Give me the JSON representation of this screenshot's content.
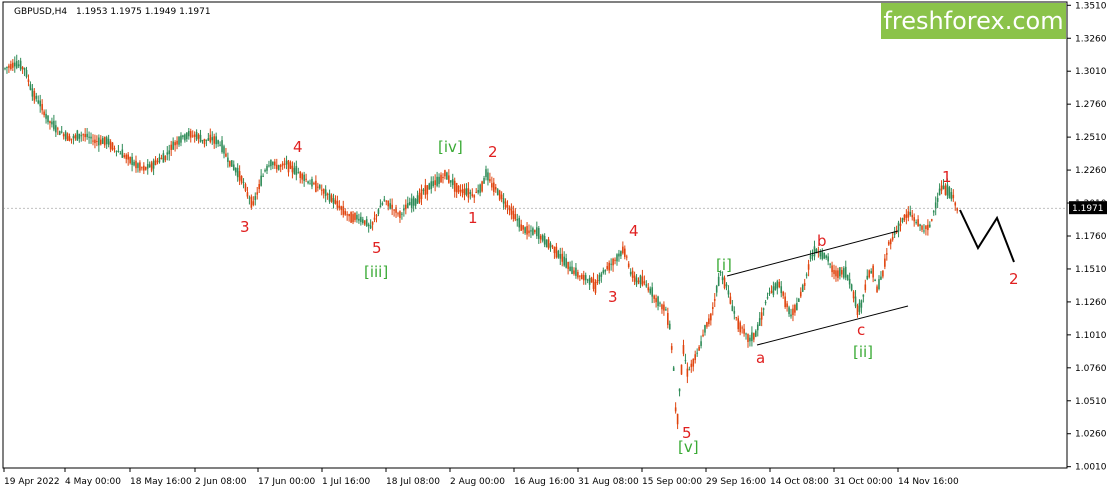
{
  "header": {
    "symbol": "GBPUSD,H4",
    "ohlc": "1.1953 1.1975 1.1949 1.1971"
  },
  "logo": {
    "text": "freshforex.com",
    "color": "#8bc34a"
  },
  "colors": {
    "bull": "#2e8b57",
    "bear": "#e0440e",
    "red_label": "#e02020",
    "green_label": "#3aaa35",
    "channel": "#000000",
    "price_tag_bg": "#000000",
    "grid": "#c8c8c8"
  },
  "chart_data": {
    "type": "candlestick",
    "title": "GBPUSD,H4",
    "ylim": [
      1.0,
      1.3535
    ],
    "yticks": [
      "1.3510",
      "1.3260",
      "1.3010",
      "1.2760",
      "1.2510",
      "1.2260",
      "1.2010",
      "1.1760",
      "1.1510",
      "1.1260",
      "1.1010",
      "1.0760",
      "1.0510",
      "1.0260",
      "1.0010"
    ],
    "xticks": [
      "19 Apr 2022",
      "4 May 00:00",
      "18 May 16:00",
      "2 Jun 08:00",
      "17 Jun 00:00",
      "1 Jul 16:00",
      "18 Jul 08:00",
      "2 Aug 00:00",
      "16 Aug 16:00",
      "31 Aug 08:00",
      "15 Sep 00:00",
      "29 Sep 16:00",
      "14 Oct 08:00",
      "31 Oct 00:00",
      "14 Nov 16:00"
    ],
    "current_price": "1.1971",
    "grid": false,
    "price_path": [
      [
        0,
        1.303
      ],
      [
        5,
        1.307
      ],
      [
        10,
        1.303
      ],
      [
        14,
        1.285
      ],
      [
        18,
        1.276
      ],
      [
        22,
        1.264
      ],
      [
        28,
        1.255
      ],
      [
        34,
        1.25
      ],
      [
        40,
        1.253
      ],
      [
        46,
        1.248
      ],
      [
        52,
        1.248
      ],
      [
        58,
        1.24
      ],
      [
        63,
        1.235
      ],
      [
        67,
        1.23
      ],
      [
        71,
        1.227
      ],
      [
        75,
        1.229
      ],
      [
        78,
        1.233
      ],
      [
        82,
        1.236
      ],
      [
        86,
        1.245
      ],
      [
        90,
        1.25
      ],
      [
        94,
        1.253
      ],
      [
        98,
        1.252
      ],
      [
        102,
        1.248
      ],
      [
        106,
        1.25
      ],
      [
        110,
        1.246
      ],
      [
        115,
        1.232
      ],
      [
        118,
        1.226
      ],
      [
        121,
        1.22
      ],
      [
        124,
        1.208
      ],
      [
        127,
        1.2
      ],
      [
        130,
        1.213
      ],
      [
        133,
        1.226
      ],
      [
        136,
        1.232
      ],
      [
        140,
        1.228
      ],
      [
        144,
        1.231
      ],
      [
        148,
        1.226
      ],
      [
        152,
        1.222
      ],
      [
        156,
        1.216
      ],
      [
        160,
        1.214
      ],
      [
        164,
        1.208
      ],
      [
        168,
        1.203
      ],
      [
        172,
        1.197
      ],
      [
        176,
        1.191
      ],
      [
        180,
        1.19
      ],
      [
        184,
        1.187
      ],
      [
        187,
        1.182
      ],
      [
        190,
        1.192
      ],
      [
        194,
        1.203
      ],
      [
        198,
        1.198
      ],
      [
        202,
        1.192
      ],
      [
        206,
        1.199
      ],
      [
        210,
        1.202
      ],
      [
        214,
        1.21
      ],
      [
        218,
        1.214
      ],
      [
        222,
        1.218
      ],
      [
        225,
        1.223
      ],
      [
        228,
        1.218
      ],
      [
        232,
        1.211
      ],
      [
        236,
        1.21
      ],
      [
        240,
        1.207
      ],
      [
        244,
        1.214
      ],
      [
        246,
        1.223
      ],
      [
        249,
        1.215
      ],
      [
        252,
        1.21
      ],
      [
        256,
        1.201
      ],
      [
        260,
        1.193
      ],
      [
        264,
        1.183
      ],
      [
        268,
        1.179
      ],
      [
        272,
        1.179
      ],
      [
        276,
        1.172
      ],
      [
        280,
        1.168
      ],
      [
        284,
        1.161
      ],
      [
        288,
        1.153
      ],
      [
        292,
        1.148
      ],
      [
        296,
        1.144
      ],
      [
        300,
        1.142
      ],
      [
        302,
        1.138
      ],
      [
        304,
        1.145
      ],
      [
        308,
        1.152
      ],
      [
        312,
        1.158
      ],
      [
        316,
        1.165
      ],
      [
        318,
        1.161
      ],
      [
        320,
        1.148
      ],
      [
        323,
        1.142
      ],
      [
        326,
        1.142
      ],
      [
        330,
        1.135
      ],
      [
        334,
        1.126
      ],
      [
        338,
        1.12
      ],
      [
        340,
        1.108
      ],
      [
        342,
        1.075
      ],
      [
        343,
        1.045
      ],
      [
        344,
        1.038
      ],
      [
        345,
        1.06
      ],
      [
        347,
        1.09
      ],
      [
        349,
        1.073
      ],
      [
        352,
        1.08
      ],
      [
        355,
        1.09
      ],
      [
        358,
        1.105
      ],
      [
        361,
        1.115
      ],
      [
        364,
        1.135
      ],
      [
        366,
        1.148
      ],
      [
        369,
        1.138
      ],
      [
        372,
        1.122
      ],
      [
        375,
        1.11
      ],
      [
        378,
        1.103
      ],
      [
        381,
        1.097
      ],
      [
        384,
        1.102
      ],
      [
        387,
        1.115
      ],
      [
        390,
        1.13
      ],
      [
        393,
        1.135
      ],
      [
        396,
        1.14
      ],
      [
        399,
        1.127
      ],
      [
        402,
        1.115
      ],
      [
        405,
        1.123
      ],
      [
        409,
        1.14
      ],
      [
        412,
        1.16
      ],
      [
        415,
        1.165
      ],
      [
        418,
        1.162
      ],
      [
        421,
        1.158
      ],
      [
        424,
        1.148
      ],
      [
        427,
        1.148
      ],
      [
        430,
        1.148
      ],
      [
        433,
        1.138
      ],
      [
        436,
        1.12
      ],
      [
        438,
        1.124
      ],
      [
        441,
        1.145
      ],
      [
        444,
        1.15
      ],
      [
        446,
        1.135
      ],
      [
        449,
        1.148
      ],
      [
        452,
        1.17
      ],
      [
        456,
        1.18
      ],
      [
        460,
        1.19
      ],
      [
        463,
        1.193
      ],
      [
        466,
        1.187
      ],
      [
        470,
        1.181
      ],
      [
        473,
        1.183
      ],
      [
        476,
        1.2
      ],
      [
        479,
        1.213
      ],
      [
        482,
        1.21
      ],
      [
        485,
        1.205
      ],
      [
        487,
        1.197
      ]
    ],
    "annotations": {
      "red": [
        "3",
        "4",
        "5",
        "1",
        "2",
        "3",
        "4",
        "5",
        "a",
        "b",
        "c",
        "1",
        "2"
      ],
      "green": [
        "[iii]",
        "[iv]",
        "[i]",
        "[v]",
        "[ii]"
      ]
    }
  }
}
